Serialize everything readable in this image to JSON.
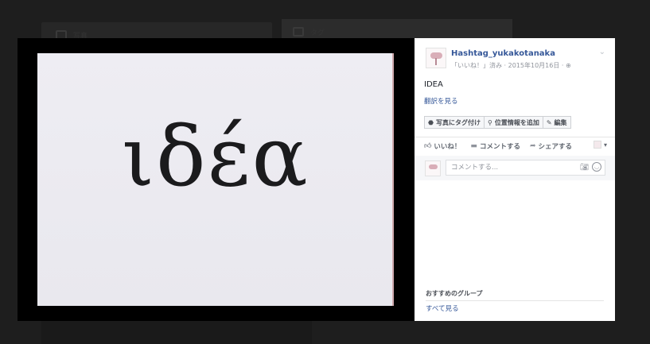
{
  "background": {
    "card1_text": "写真",
    "card2_text": "タグ"
  },
  "photo": {
    "word": "ιδέα"
  },
  "post": {
    "author": "Hashtag_yukakotanaka",
    "meta": "「いいね！」済み · 2015年10月16日 ·",
    "caption": "IDEA",
    "translate": "翻訳を見る",
    "buttons": {
      "tag": "写真にタグ付け",
      "location": "位置情報を追加",
      "edit": "編集"
    },
    "actions": {
      "like": "いいね！",
      "comment": "コメントする",
      "share": "シェアする"
    },
    "comment_placeholder": "コメントする...",
    "groups_heading": "おすすめのグループ",
    "see_all": "すべて見る"
  },
  "colors": {
    "link": "#365899",
    "overlay": "#1c1c1c"
  }
}
